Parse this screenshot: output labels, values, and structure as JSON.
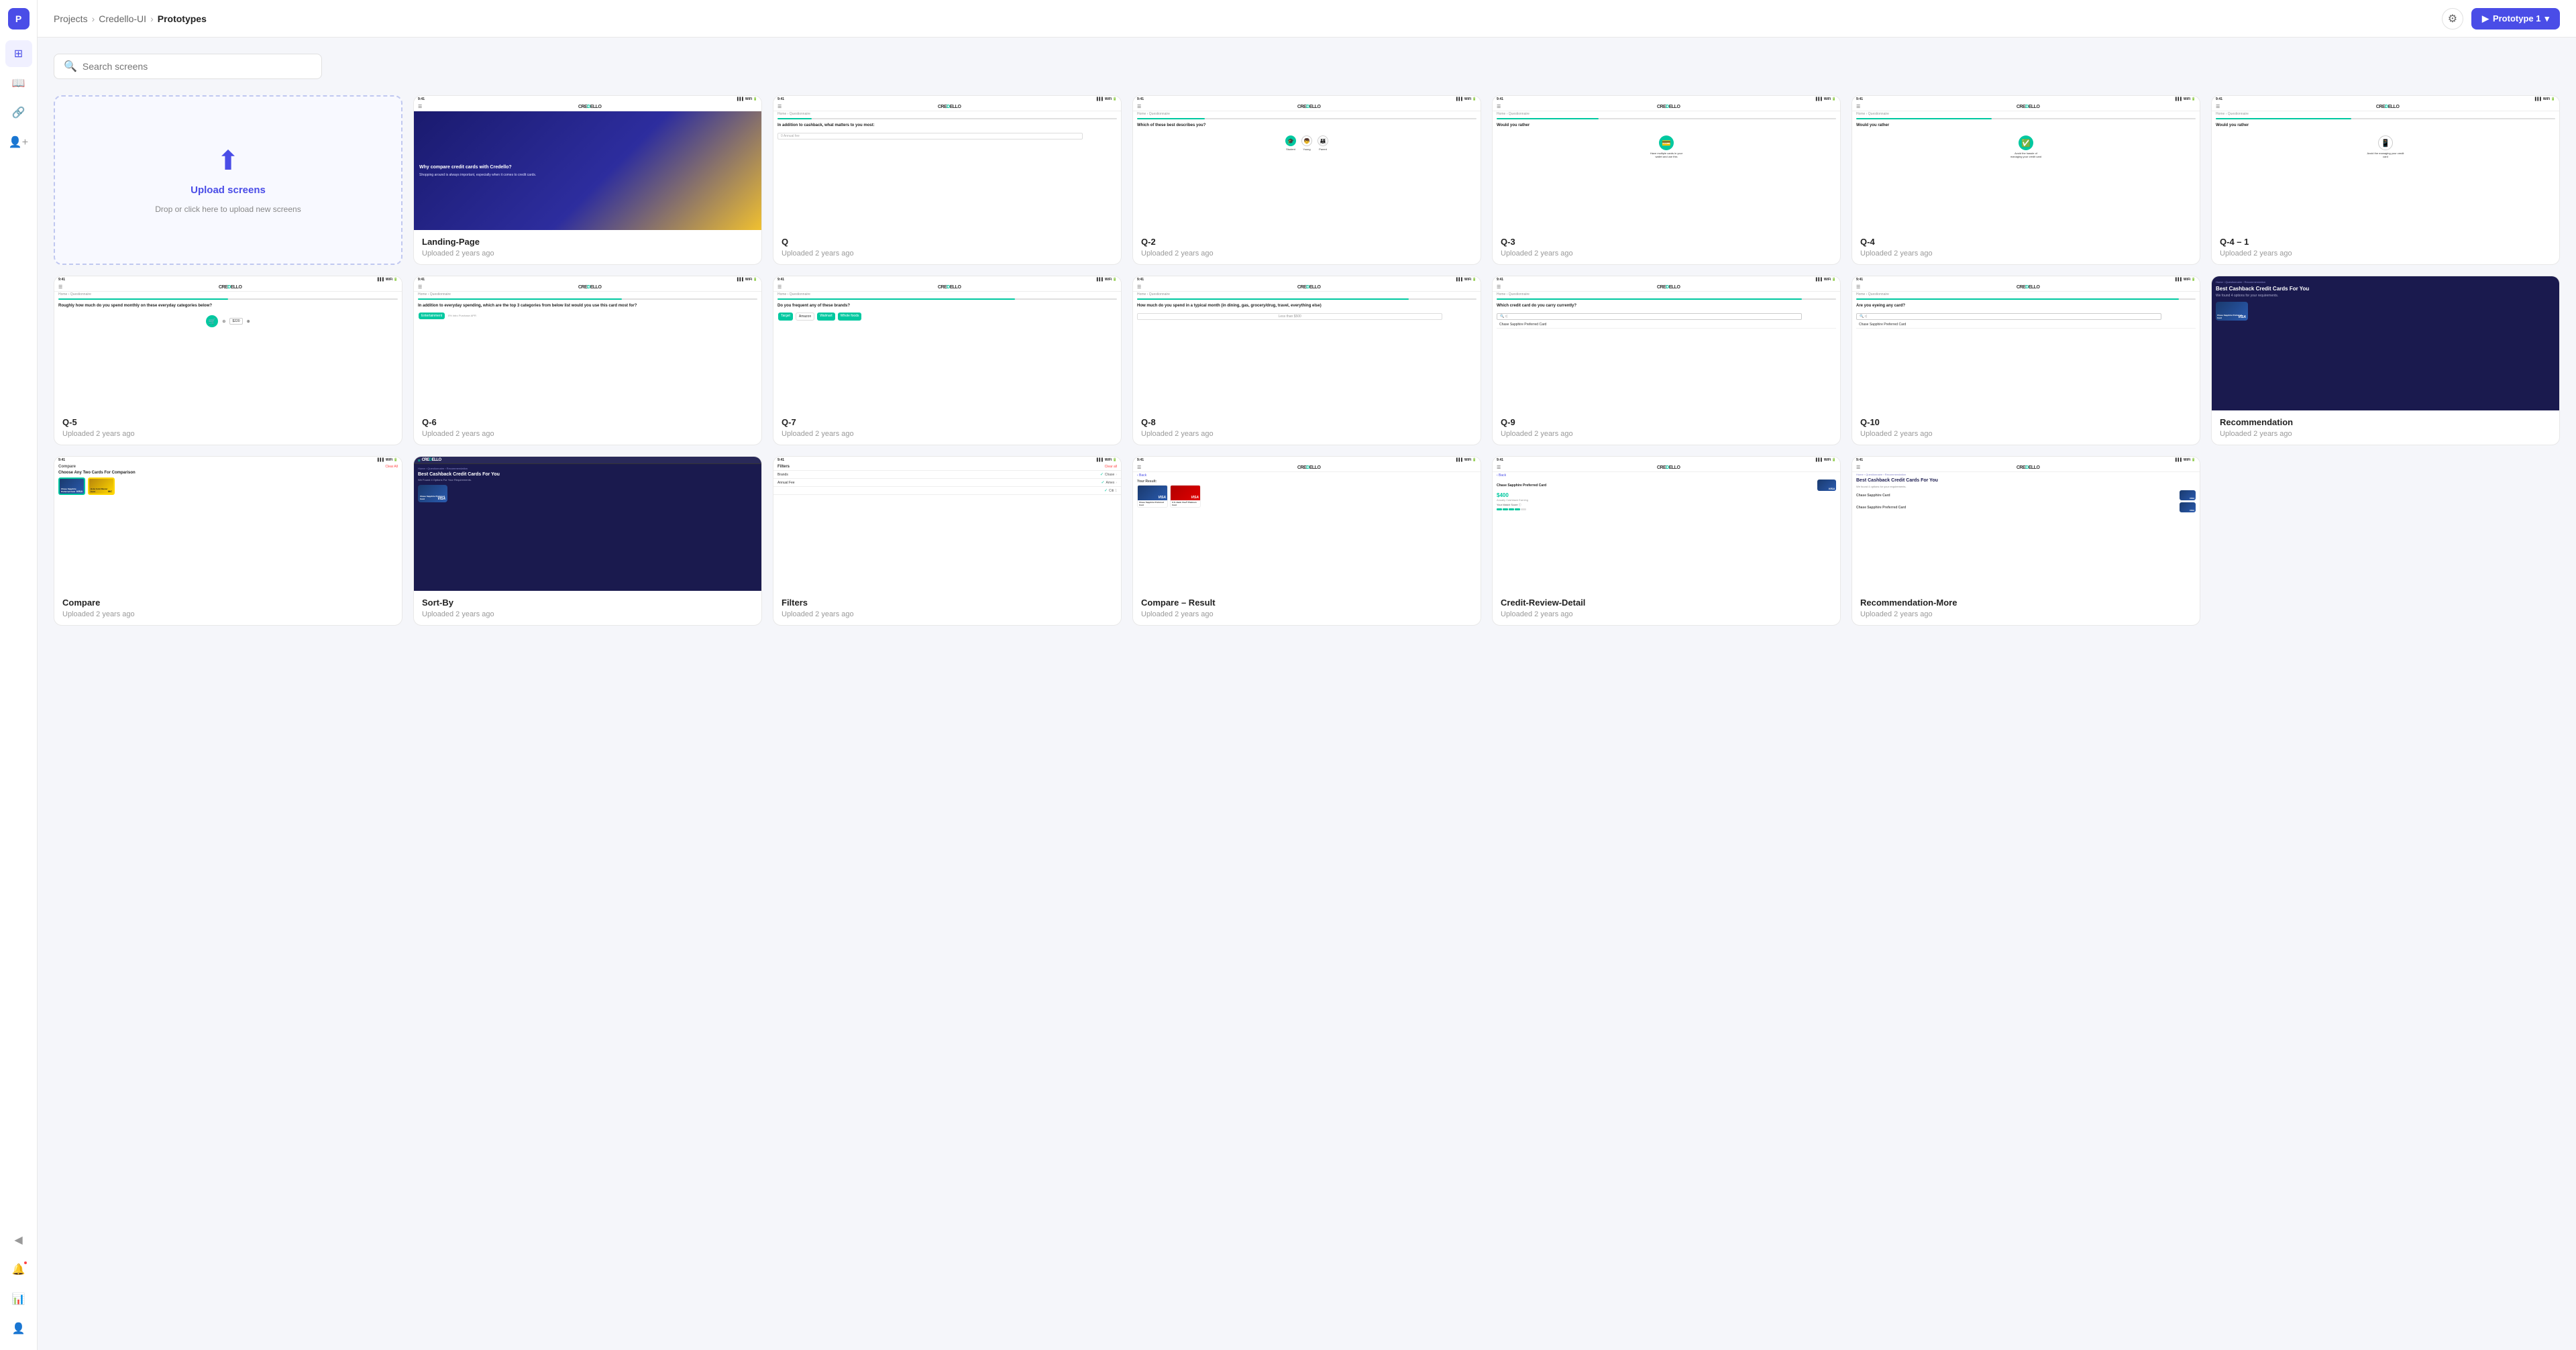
{
  "app": {
    "logo": "P",
    "title": "Prototypes"
  },
  "breadcrumb": {
    "items": [
      "Projects",
      "Credello-UI",
      "Prototypes"
    ]
  },
  "header": {
    "prototype_btn": "Prototype 1"
  },
  "search": {
    "placeholder": "Search screens"
  },
  "upload": {
    "title": "Upload screens",
    "subtitle": "Drop or click here to upload new screens"
  },
  "screens": [
    {
      "name": "Landing-Page",
      "date": "Uploaded 2 years ago",
      "type": "landing"
    },
    {
      "name": "Q",
      "date": "Uploaded 2 years ago",
      "type": "q",
      "progress": 10,
      "question": "In addition to cashback, what matters to you most?"
    },
    {
      "name": "Q-2",
      "date": "Uploaded 2 years ago",
      "type": "q2",
      "progress": 20,
      "question": "Which of these best describes you?"
    },
    {
      "name": "Q-3",
      "date": "Uploaded 2 years ago",
      "type": "q3",
      "progress": 30,
      "question": "Would you rather"
    },
    {
      "name": "Q-4",
      "date": "Uploaded 2 years ago",
      "type": "q4",
      "progress": 40,
      "question": "Would you rather"
    },
    {
      "name": "Q-4-1",
      "date": "Uploaded 2 years ago",
      "type": "q4b",
      "progress": 40,
      "question": "Would you rather"
    },
    {
      "name": "Q-5",
      "date": "Uploaded 2 years ago",
      "type": "q5",
      "progress": 50,
      "question": "Roughly how much do you spend monthly on these everyday categories below?"
    },
    {
      "name": "Q-6",
      "date": "Uploaded 2 years ago",
      "type": "q6",
      "progress": 60,
      "question": "In addition to everyday spending, which are the top 3 categories from below list would you use this card most for?"
    },
    {
      "name": "Q-7",
      "date": "Uploaded 2 years ago",
      "type": "q7",
      "progress": 70,
      "question": "Do you frequent any of these brands?"
    },
    {
      "name": "Q-8",
      "date": "Uploaded 2 years ago",
      "type": "q8",
      "progress": 80,
      "question": "How much do you spend in a typical month (in dining, gas, grocery/drug, travel, everything else)"
    },
    {
      "name": "Q-9",
      "date": "Uploaded 2 years ago",
      "type": "q9",
      "progress": 90,
      "question": "Which credit card do you carry currently?"
    },
    {
      "name": "Q-10",
      "date": "Uploaded 2 years ago",
      "type": "q10",
      "progress": 95,
      "question": "Are you eyeing any card?"
    },
    {
      "name": "Recommendation",
      "date": "Uploaded 2 years ago",
      "type": "recommendation"
    },
    {
      "name": "Compare",
      "date": "Uploaded 2 years ago",
      "type": "compare"
    },
    {
      "name": "Sort-By",
      "date": "Uploaded 2 years ago",
      "type": "sortby"
    },
    {
      "name": "Filters",
      "date": "Uploaded 2 years ago",
      "type": "filters"
    },
    {
      "name": "Compare – Result",
      "date": "Uploaded 2 years ago",
      "type": "compare-result"
    },
    {
      "name": "Credit-Review-Detail",
      "date": "Uploaded 2 years ago",
      "type": "credit-review"
    },
    {
      "name": "Recommendation-More",
      "date": "Uploaded 2 years ago",
      "type": "rec-more"
    }
  ],
  "sidebar": {
    "items": [
      {
        "icon": "⊞",
        "label": "Projects",
        "active": false
      },
      {
        "icon": "📖",
        "label": "Book",
        "active": false
      },
      {
        "icon": "🔗",
        "label": "Link",
        "active": false
      },
      {
        "icon": "👤+",
        "label": "Add User",
        "active": false
      }
    ],
    "bottom": [
      {
        "icon": "◀",
        "label": "Back"
      },
      {
        "icon": "🔔",
        "label": "Notifications",
        "badge": true
      },
      {
        "icon": "📊",
        "label": "Analytics"
      },
      {
        "icon": "👤",
        "label": "Profile"
      }
    ]
  }
}
